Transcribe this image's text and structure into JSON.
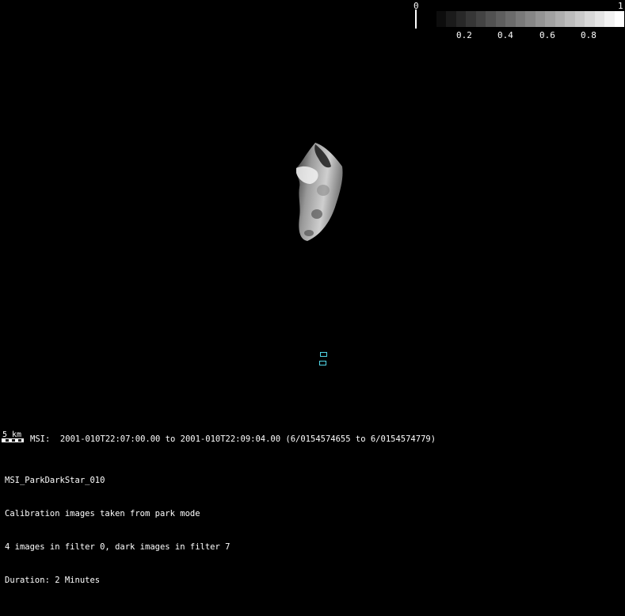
{
  "colorbar": {
    "min_label": "0",
    "max_label": "1",
    "tick_labels": [
      "0.2",
      "0.4",
      "0.6",
      "0.8"
    ],
    "gradient_start": "#000000",
    "gradient_end": "#ffffff",
    "levels": 20
  },
  "asteroid": {
    "name_icon": "asteroid-image"
  },
  "footprint_color": "#52d7e8",
  "scale": {
    "label": "5 km"
  },
  "observation": {
    "line": "MSI:  2001-010T22:07:00.00 to 2001-010T22:09:04.00 (6/0154574655 to 6/0154574779)"
  },
  "info": {
    "title": "MSI_ParkDarkStar_010",
    "line1": "Calibration images taken from park mode",
    "line2": "4 images in filter 0, dark images in filter 7",
    "line3": "Duration: 2 Minutes"
  }
}
